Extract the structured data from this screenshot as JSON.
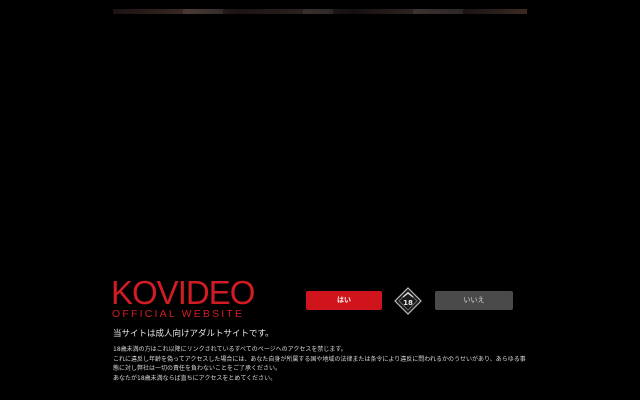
{
  "logo": {
    "main": "KOVIDEO",
    "sub": "OFFICIAL WEBSITE"
  },
  "age_gate": {
    "yes_label": "はい",
    "no_label": "いいえ",
    "badge_icon": "18-plus-badge-icon",
    "tagline": "当サイトは成人向けアダルトサイトです。",
    "notice": [
      "18歳未満の方はこれ以降にリンクされているすべてのページへのアクセスを禁じます。",
      "これに違反し年齢を偽ってアクセスした場合には、あなた自身が所属する国や地域の法律または条令により違反に問われるかのうせいがあり、あらゆる事",
      "態に対し弊社は一切の責任を負わないことをご了承ください。",
      "あなたが18歳未満ならば直ちにアクセスをとめてください。"
    ]
  },
  "colors": {
    "background": "#000000",
    "accent": "#d0141c",
    "secondary_button": "#4a4a4a"
  }
}
